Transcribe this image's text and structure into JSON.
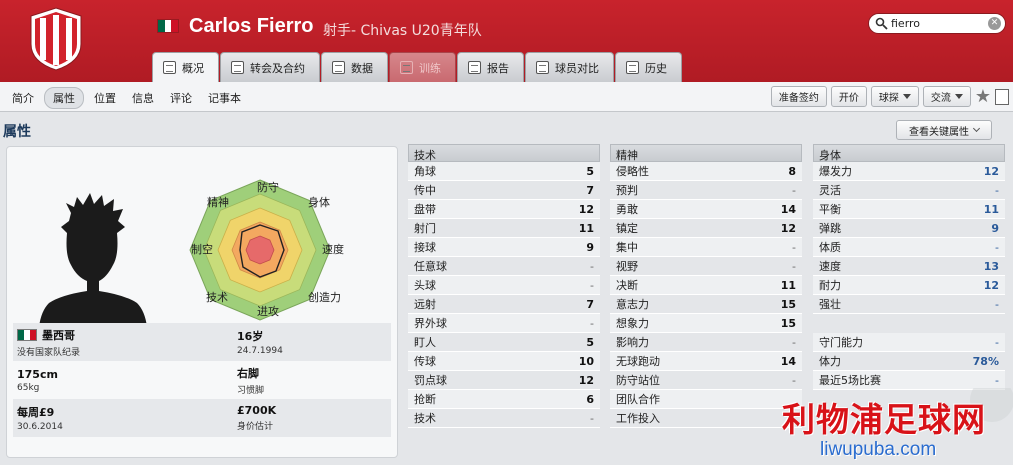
{
  "header": {
    "player_name": "Carlos Fierro",
    "position_club": "射手- Chivas U20青年队",
    "search_value": "fierro",
    "colors": {
      "brand_red": "#c8232c",
      "flag_green": "#006847",
      "flag_white": "#ffffff",
      "flag_red": "#ce1126"
    }
  },
  "tabs": [
    {
      "label": "概况",
      "icon": "profile-icon"
    },
    {
      "label": "转会及合约",
      "icon": "contract-icon"
    },
    {
      "label": "数据",
      "icon": "stats-icon"
    },
    {
      "label": "训练",
      "icon": "training-icon"
    },
    {
      "label": "报告",
      "icon": "report-icon"
    },
    {
      "label": "球员对比",
      "icon": "compare-icon"
    },
    {
      "label": "历史",
      "icon": "history-icon"
    }
  ],
  "subnav": {
    "links": [
      "简介",
      "属性",
      "位置",
      "信息",
      "评论",
      "记事本"
    ],
    "actions": {
      "prepare_sign": "准备签约",
      "bid": "开价",
      "scout": "球探",
      "interact": "交流"
    }
  },
  "section": {
    "title": "属性",
    "key_attr_button": "查看关键属性"
  },
  "radar": {
    "labels": {
      "defense": "防守",
      "physical": "身体",
      "speed": "速度",
      "creativity": "创造力",
      "attack": "进攻",
      "technique": "技术",
      "aerial": "制空",
      "mental": "精神"
    }
  },
  "info": {
    "nationality": "墨西哥",
    "intl_record": "没有国家队纪录",
    "age": "16岁",
    "dob": "24.7.1994",
    "height": "175cm",
    "weight": "65kg",
    "foot": "右脚",
    "foot_label": "习惯脚",
    "wage": "每周£9",
    "contract_end": "30.6.2014",
    "value": "£700K",
    "value_label": "身价估计"
  },
  "technical": {
    "header": "技术",
    "rows": [
      {
        "name": "角球",
        "value": "5"
      },
      {
        "name": "传中",
        "value": "7"
      },
      {
        "name": "盘带",
        "value": "12"
      },
      {
        "name": "射门",
        "value": "11"
      },
      {
        "name": "接球",
        "value": "9"
      },
      {
        "name": "任意球",
        "value": "-"
      },
      {
        "name": "头球",
        "value": "-"
      },
      {
        "name": "远射",
        "value": "7"
      },
      {
        "name": "界外球",
        "value": "-"
      },
      {
        "name": "盯人",
        "value": "5"
      },
      {
        "name": "传球",
        "value": "10"
      },
      {
        "name": "罚点球",
        "value": "12"
      },
      {
        "name": "抢断",
        "value": "6"
      },
      {
        "name": "技术",
        "value": "-"
      }
    ]
  },
  "mental": {
    "header": "精神",
    "rows": [
      {
        "name": "侵略性",
        "value": "8"
      },
      {
        "name": "预判",
        "value": "-"
      },
      {
        "name": "勇敢",
        "value": "14"
      },
      {
        "name": "镇定",
        "value": "12"
      },
      {
        "name": "集中",
        "value": "-"
      },
      {
        "name": "视野",
        "value": "-"
      },
      {
        "name": "决断",
        "value": "11"
      },
      {
        "name": "意志力",
        "value": "15"
      },
      {
        "name": "想象力",
        "value": "15"
      },
      {
        "name": "影响力",
        "value": "-"
      },
      {
        "name": "无球跑动",
        "value": "14"
      },
      {
        "name": "防守站位",
        "value": "-"
      },
      {
        "name": "团队合作",
        "value": ""
      },
      {
        "name": "工作投入",
        "value": ""
      }
    ]
  },
  "physical": {
    "header": "身体",
    "rows": [
      {
        "name": "爆发力",
        "value": "12"
      },
      {
        "name": "灵活",
        "value": "-"
      },
      {
        "name": "平衡",
        "value": "11"
      },
      {
        "name": "弹跳",
        "value": "9"
      },
      {
        "name": "体质",
        "value": "-"
      },
      {
        "name": "速度",
        "value": "13"
      },
      {
        "name": "耐力",
        "value": "12"
      },
      {
        "name": "强壮",
        "value": "-"
      }
    ],
    "extra_rows": [
      {
        "name": "守门能力",
        "value": "-"
      },
      {
        "name": "体力",
        "value": "78%"
      },
      {
        "name": "最近5场比赛",
        "value": "-"
      }
    ]
  },
  "watermark": {
    "main": "利物浦足球网",
    "sub": "liwupuba.com"
  }
}
